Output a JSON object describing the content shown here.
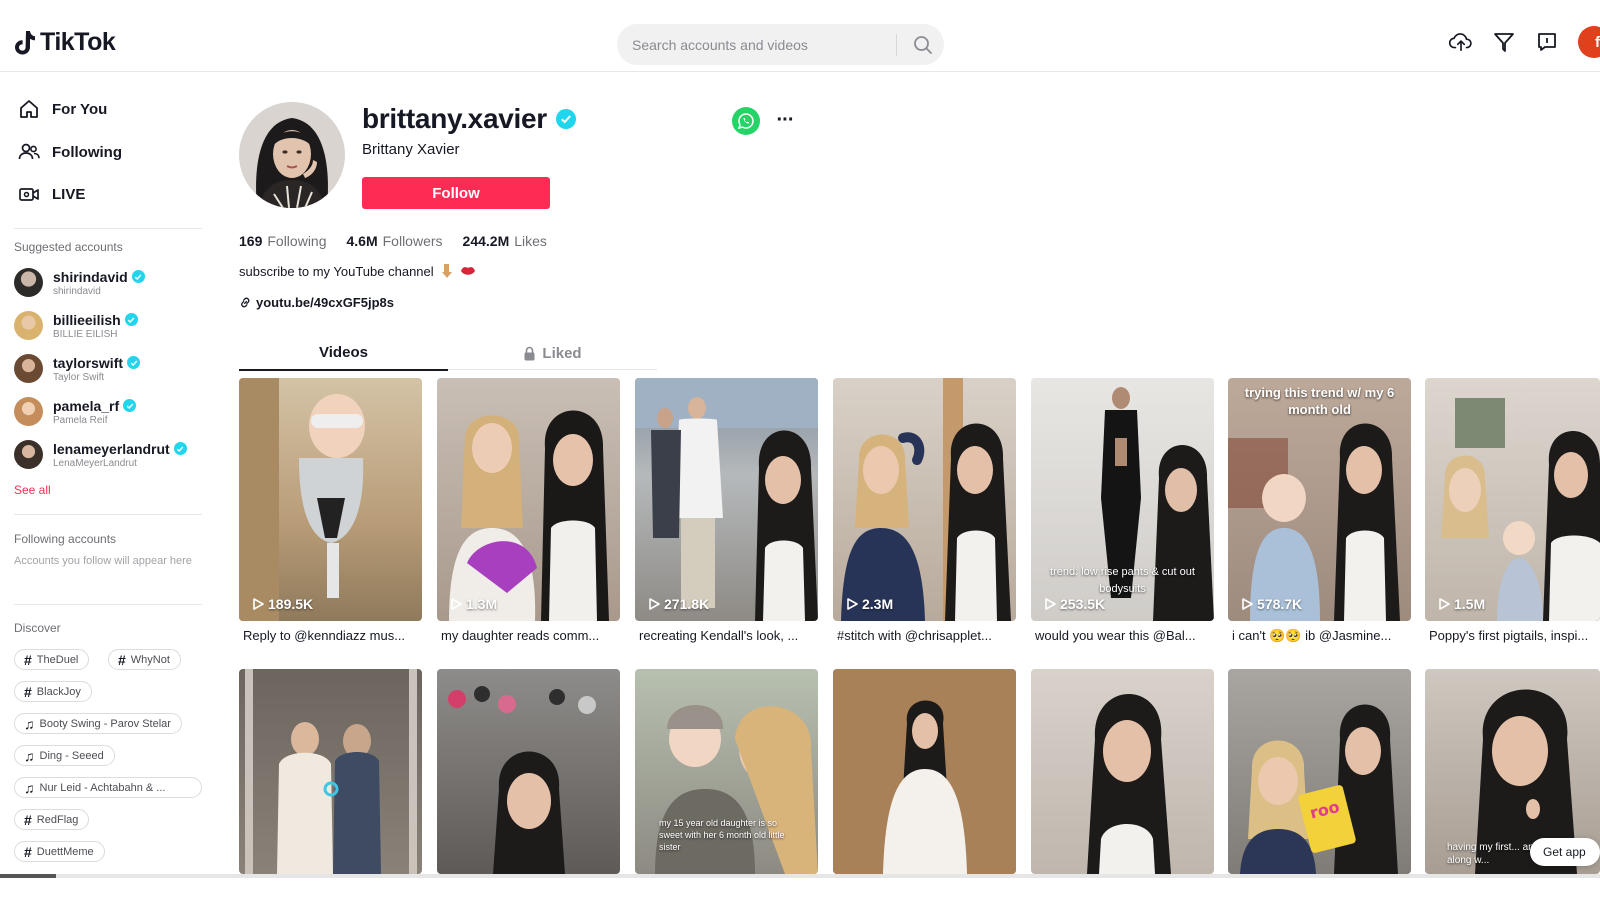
{
  "header": {
    "logo_text": "TikTok",
    "search_placeholder": "Search accounts and videos",
    "icons": [
      "upload-icon",
      "inbox-send-icon",
      "messages-icon"
    ],
    "avatar_initial": "f"
  },
  "sidebar": {
    "nav": [
      {
        "label": "For You",
        "icon": "home-icon"
      },
      {
        "label": "Following",
        "icon": "people-icon"
      },
      {
        "label": "LIVE",
        "icon": "live-icon"
      }
    ],
    "suggested_title": "Suggested accounts",
    "suggested": [
      {
        "name": "shirindavid",
        "sub": "shirindavid"
      },
      {
        "name": "billieeilish",
        "sub": "BILLIE EILISH"
      },
      {
        "name": "taylorswift",
        "sub": "Taylor Swift"
      },
      {
        "name": "pamela_rf",
        "sub": "Pamela Reif"
      },
      {
        "name": "lenameyerlandrut",
        "sub": "LenaMeyerLandrut"
      }
    ],
    "see_all": "See all",
    "following_title": "Following accounts",
    "following_hint": "Accounts you follow will appear here",
    "discover_title": "Discover",
    "discover": [
      {
        "type": "hashtag",
        "label": "TheDuel"
      },
      {
        "type": "hashtag",
        "label": "WhyNot"
      },
      {
        "type": "hashtag",
        "label": "BlackJoy"
      },
      {
        "type": "music",
        "label": "Booty Swing - Parov Stelar"
      },
      {
        "type": "music",
        "label": "Ding - Seeed"
      },
      {
        "type": "music",
        "label": "Nur Leid - Achtabahn & ..."
      },
      {
        "type": "hashtag",
        "label": "RedFlag"
      },
      {
        "type": "hashtag",
        "label": "DuettMeme"
      }
    ]
  },
  "profile": {
    "username": "brittany.xavier",
    "display_name": "Brittany Xavier",
    "follow_label": "Follow",
    "more_label": "···",
    "stats": [
      {
        "num": "169",
        "label": "Following"
      },
      {
        "num": "4.6M",
        "label": "Followers"
      },
      {
        "num": "244.2M",
        "label": "Likes"
      }
    ],
    "bio": "subscribe to my YouTube channel",
    "link": "youtu.be/49cxGF5jp8s"
  },
  "tabs": {
    "videos": "Videos",
    "liked": "Liked"
  },
  "videos_row1": [
    {
      "views": "189.5K",
      "caption": "Reply to @kenndiazz mus...",
      "overlay": ""
    },
    {
      "views": "1.3M",
      "caption": "my daughter reads comm...",
      "overlay": ""
    },
    {
      "views": "271.8K",
      "caption": "recreating Kendall's look, ...",
      "overlay": ""
    },
    {
      "views": "2.3M",
      "caption": "#stitch with @chrisapplet...",
      "overlay": ""
    },
    {
      "views": "253.5K",
      "caption": "would you wear this @Bal...",
      "overlay": "trend: low rise pants & cut out bodysuits"
    },
    {
      "views": "578.7K",
      "caption": "i can't 🥺🥺 ib @Jasmine...",
      "overlay": "trying this trend w/ my 6 month old"
    },
    {
      "views": "1.5M",
      "caption": "Poppy's first pigtails, inspi...",
      "overlay": ""
    }
  ],
  "videos_row2": [
    {
      "overlay": ""
    },
    {
      "overlay": ""
    },
    {
      "overlay": "my 15 year old daughter is so sweet with her 6 month old little sister"
    },
    {
      "overlay": ""
    },
    {
      "overlay": ""
    },
    {
      "overlay": ""
    },
    {
      "overlay": "having my first... and bringing her along w..."
    }
  ],
  "get_app": "Get app",
  "colors": {
    "accent": "#fe2c55",
    "verified": "#20d5ec",
    "whatsapp": "#25d366"
  }
}
